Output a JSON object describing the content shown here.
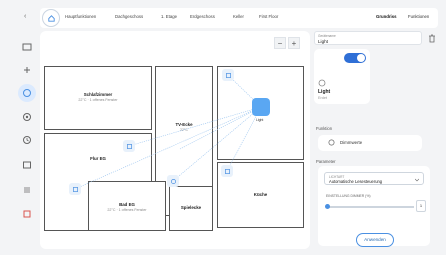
{
  "topbar": {
    "crumbs": [
      "Hauptfunktionen",
      "Dachgeschoss",
      "1. Etage",
      "Erdgeschoss",
      "Keller",
      "First Floor"
    ],
    "segments": [
      "Grundriss",
      "Funktionen"
    ]
  },
  "sidebar": {
    "icons": [
      "grid-icon",
      "plus-icon",
      "floorplan-icon",
      "circle-icon",
      "settings-icon",
      "image-icon",
      "list-icon",
      "users-icon"
    ]
  },
  "canvas": {
    "zoom_out": "−",
    "zoom_in": "+",
    "rooms": [
      {
        "name": "Schlafzimmer",
        "sub": "22°C · 1 offenes Fenster"
      },
      {
        "name": "TV-Ecke",
        "sub": "22°C"
      },
      {
        "name": "Flur EG",
        "sub": ""
      },
      {
        "name": "Küche",
        "sub": ""
      },
      {
        "name": "Bad EG",
        "sub": "22°C · 1 offenes Fenster"
      },
      {
        "name": "Spielecke",
        "sub": ""
      }
    ],
    "light_node_label": "Light"
  },
  "panel": {
    "name_label": "Gerätename",
    "name_value": "Light",
    "device_card": {
      "title": "Light",
      "subtitle": "Erdet",
      "toggle": "on"
    },
    "function_label": "Funktion",
    "function_value": "Dimmwerte",
    "parameters_label": "Parameter",
    "dropdown_label": "LICHTART",
    "dropdown_value": "Automatische Lesesteuerung",
    "slider_label": "EINSTELLUNG DIMMER (%)",
    "slider_value": "1",
    "apply": "Anwenden"
  },
  "colors": {
    "accent": "#5aa7f2",
    "background": "#f3f4f6"
  }
}
